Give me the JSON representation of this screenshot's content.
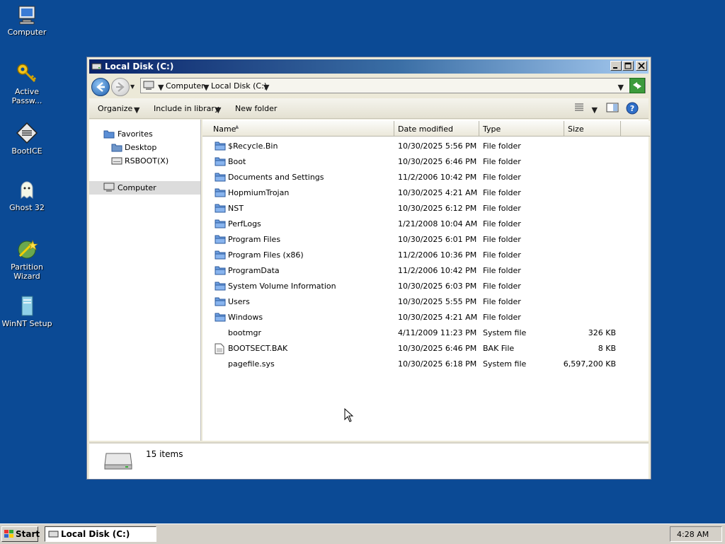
{
  "desktop": {
    "icons": [
      {
        "label": "Computer",
        "icon": "computer-icon"
      },
      {
        "label": "Active Passw...",
        "icon": "key-icon"
      },
      {
        "label": "BootICE",
        "icon": "bootice-icon"
      },
      {
        "label": "Ghost 32",
        "icon": "ghost-icon"
      },
      {
        "label": "Partition Wizard",
        "icon": "partition-wizard-icon"
      },
      {
        "label": "WinNT Setup",
        "icon": "setup-icon"
      }
    ]
  },
  "window": {
    "title": "Local Disk (C:)",
    "address": {
      "segments": [
        "Computer",
        "Local Disk (C:)"
      ]
    },
    "toolbar": {
      "organize": "Organize",
      "include_in_library": "Include in library",
      "new_folder": "New folder"
    },
    "nav_pane": {
      "favorites": "Favorites",
      "items": [
        "Desktop",
        "RSBOOT(X)"
      ],
      "computer": "Computer"
    },
    "columns": {
      "name": "Name",
      "date_modified": "Date modified",
      "type": "Type",
      "size": "Size"
    },
    "files": [
      {
        "name": "$Recycle.Bin",
        "date": "10/30/2025 5:56 PM",
        "type": "File folder",
        "size": "",
        "icon": "folder-icon"
      },
      {
        "name": "Boot",
        "date": "10/30/2025 6:46 PM",
        "type": "File folder",
        "size": "",
        "icon": "folder-icon"
      },
      {
        "name": "Documents and Settings",
        "date": "11/2/2006 10:42 PM",
        "type": "File folder",
        "size": "",
        "icon": "folder-icon"
      },
      {
        "name": "HopmiumTrojan",
        "date": "10/30/2025 4:21 AM",
        "type": "File folder",
        "size": "",
        "icon": "folder-icon"
      },
      {
        "name": "NST",
        "date": "10/30/2025 6:12 PM",
        "type": "File folder",
        "size": "",
        "icon": "folder-icon"
      },
      {
        "name": "PerfLogs",
        "date": "1/21/2008 10:04 AM",
        "type": "File folder",
        "size": "",
        "icon": "folder-icon"
      },
      {
        "name": "Program Files",
        "date": "10/30/2025 6:01 PM",
        "type": "File folder",
        "size": "",
        "icon": "folder-icon"
      },
      {
        "name": "Program Files (x86)",
        "date": "11/2/2006 10:36 PM",
        "type": "File folder",
        "size": "",
        "icon": "folder-icon"
      },
      {
        "name": "ProgramData",
        "date": "11/2/2006 10:42 PM",
        "type": "File folder",
        "size": "",
        "icon": "folder-icon"
      },
      {
        "name": "System Volume Information",
        "date": "10/30/2025 6:03 PM",
        "type": "File folder",
        "size": "",
        "icon": "folder-icon"
      },
      {
        "name": "Users",
        "date": "10/30/2025 5:55 PM",
        "type": "File folder",
        "size": "",
        "icon": "folder-icon"
      },
      {
        "name": "Windows",
        "date": "10/30/2025 4:21 AM",
        "type": "File folder",
        "size": "",
        "icon": "folder-icon"
      },
      {
        "name": "bootmgr",
        "date": "4/11/2009 11:23 PM",
        "type": "System file",
        "size": "326 KB",
        "icon": ""
      },
      {
        "name": "BOOTSECT.BAK",
        "date": "10/30/2025 6:46 PM",
        "type": "BAK File",
        "size": "8 KB",
        "icon": "file-icon"
      },
      {
        "name": "pagefile.sys",
        "date": "10/30/2025 6:18 PM",
        "type": "System file",
        "size": "6,597,200 KB",
        "icon": ""
      }
    ],
    "status": {
      "item_count": "15 items"
    }
  },
  "taskbar": {
    "start": "Start",
    "task_label": "Local Disk (C:)",
    "clock": "4:28 AM"
  },
  "colors": {
    "desktop": "#0b4a95",
    "titlebar_start": "#0a246a",
    "folder": "#5b8fd6"
  }
}
